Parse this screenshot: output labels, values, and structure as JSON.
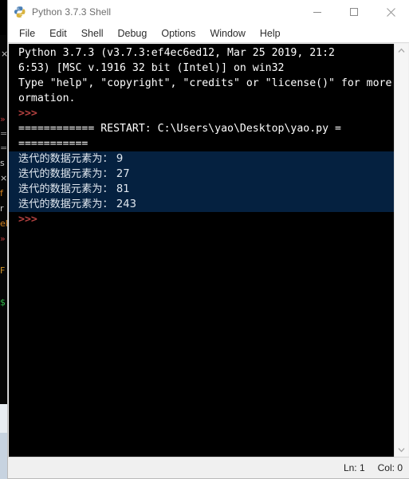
{
  "window": {
    "title": "Python 3.7.3 Shell",
    "icon": "python-logo-icon",
    "controls": {
      "minimize": "minimize-icon",
      "maximize": "maximize-icon",
      "close": "close-icon"
    }
  },
  "menu": {
    "items": [
      {
        "label": "File"
      },
      {
        "label": "Edit"
      },
      {
        "label": "Shell"
      },
      {
        "label": "Debug"
      },
      {
        "label": "Options"
      },
      {
        "label": "Window"
      },
      {
        "label": "Help"
      }
    ]
  },
  "console": {
    "background": "#000000",
    "selection_color": "#052140",
    "prompt_color": "#b2403f",
    "lines": [
      {
        "type": "banner",
        "text": "Python 3.7.3 (v3.7.3:ef4ec6ed12, Mar 25 2019, 21:2"
      },
      {
        "type": "banner",
        "text": "6:53) [MSC v.1916 32 bit (Intel)] on win32"
      },
      {
        "type": "banner",
        "text": "Type \"help\", \"copyright\", \"credits\" or \"license()\" for more inf"
      },
      {
        "type": "banner",
        "text": "ormation."
      },
      {
        "type": "prompt",
        "text": ">>>"
      },
      {
        "type": "restart",
        "text": "============ RESTART: C:\\Users\\yao\\Desktop\\yao.py ="
      },
      {
        "type": "restart",
        "text": "==========="
      },
      {
        "type": "output",
        "selected": true,
        "text": "迭代的数据元素为： 9"
      },
      {
        "type": "output",
        "selected": true,
        "text": "迭代的数据元素为： 27"
      },
      {
        "type": "output",
        "selected": true,
        "text": "迭代的数据元素为： 81"
      },
      {
        "type": "output",
        "selected": true,
        "text": "迭代的数据元素为： 243"
      },
      {
        "type": "prompt",
        "text": ">>>"
      }
    ]
  },
  "scrollbar": {
    "up_arrow": "chevron-up-icon",
    "down_arrow": "chevron-down-icon"
  },
  "status_bar": {
    "line": "Ln: 1",
    "column": "Col: 0"
  }
}
